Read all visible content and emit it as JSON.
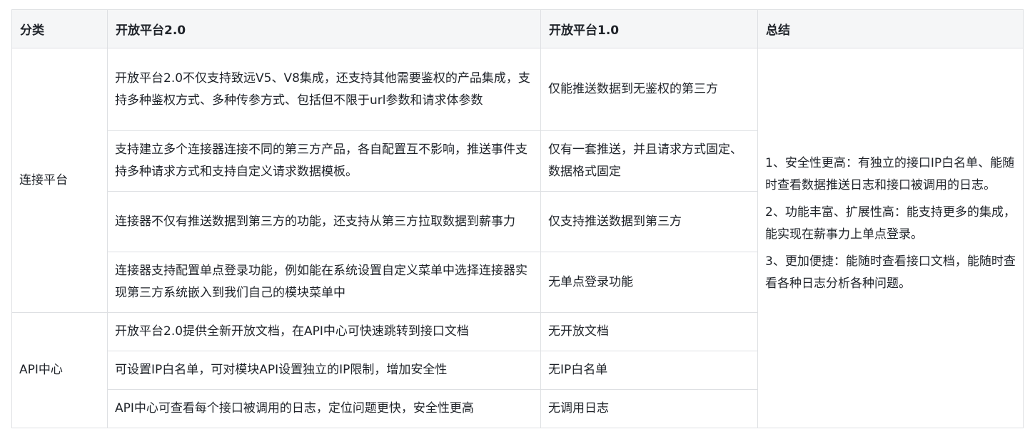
{
  "headers": [
    "分类",
    "开放平台2.0",
    "开放平台1.0",
    "总结"
  ],
  "groups": [
    {
      "category": "连接平台",
      "rows": [
        {
          "v2": "开放平台2.0不仅支持致远V5、V8集成，还支持其他需要鉴权的产品集成，支持多种鉴权方式、多种传参方式、包括但不限于url参数和请求体参数",
          "v1": "仅能推送数据到无鉴权的第三方"
        },
        {
          "v2": "支持建立多个连接器连接不同的第三方产品，各自配置互不影响，推送事件支持多种请求方式和支持自定义请求数据模板。",
          "v1": "仅有一套推送，并且请求方式固定、数据格式固定"
        },
        {
          "v2": "连接器不仅有推送数据到第三方的功能，还支持从第三方拉取数据到薪事力",
          "v1": "仅支持推送数据到第三方"
        },
        {
          "v2": "连接器支持配置单点登录功能，例如能在系统设置自定义菜单中选择连接器实现第三方系统嵌入到我们自己的模块菜单中",
          "v1": "无单点登录功能"
        }
      ]
    },
    {
      "category": "API中心",
      "rows": [
        {
          "v2": "开放平台2.0提供全新开放文档，在API中心可快速跳转到接口文档",
          "v1": "无开放文档"
        },
        {
          "v2": "可设置IP白名单，可对模块API设置独立的IP限制，增加安全性",
          "v1": "无IP白名单"
        },
        {
          "v2": "API中心可查看每个接口被调用的日志，定位问题更快，安全性更高",
          "v1": "无调用日志"
        }
      ]
    }
  ],
  "summary": [
    "1、安全性更高：有独立的接口IP白名单、能随时查看数据推送日志和接口被调用的日志。",
    "2、功能丰富、扩展性高：能支持更多的集成，能实现在薪事力上单点登录。",
    "3、更加便捷：能随时查看接口文档，能随时查看各种日志分析各种问题。"
  ]
}
